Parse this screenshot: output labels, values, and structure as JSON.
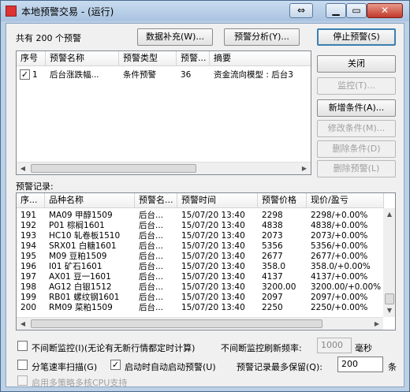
{
  "window": {
    "title": "本地预警交易 - (运行)"
  },
  "top": {
    "count_label": "共有 200 个预警",
    "data_fill_button": "数据补充(W)...",
    "analysis_button": "预警分析(Y)...",
    "stop_button": "停止预警(S)"
  },
  "side_buttons": {
    "close": "关闭",
    "monitor": "监控(T)...",
    "add_condition": "新增条件(A)...",
    "edit_condition": "修改条件(M)...",
    "delete_condition": "删除条件(D)",
    "delete_alert": "删除预警(L)"
  },
  "alert_list": {
    "columns": [
      "序号",
      "预警名称",
      "预警类型",
      "预警...",
      "摘要"
    ],
    "rows": [
      {
        "checked": true,
        "index": "1",
        "name": "后台涨跌幅...",
        "type": "条件预警",
        "count": "36",
        "summary": "资金流向模型 : 后台3"
      }
    ]
  },
  "records": {
    "label": "预警记录:",
    "columns": [
      "序...",
      "品种名称",
      "预警名...",
      "预警时间",
      "预警价格",
      "现价/盈亏"
    ],
    "rows": [
      {
        "no": "191",
        "name": "MA09 甲醇1509",
        "alert": "后台...",
        "time": "15/07/20 13:40",
        "price": "2298",
        "current": "2298/+0.00%"
      },
      {
        "no": "192",
        "name": "P01 棕榈1601",
        "alert": "后台...",
        "time": "15/07/20 13:40",
        "price": "4838",
        "current": "4838/+0.00%"
      },
      {
        "no": "193",
        "name": "HC10 轧卷板1510",
        "alert": "后台...",
        "time": "15/07/20 13:40",
        "price": "2073",
        "current": "2073/+0.00%"
      },
      {
        "no": "194",
        "name": "SRX01 白糖1601",
        "alert": "后台...",
        "time": "15/07/20 13:40",
        "price": "5356",
        "current": "5356/+0.00%"
      },
      {
        "no": "195",
        "name": "M09 豆粕1509",
        "alert": "后台...",
        "time": "15/07/20 13:40",
        "price": "2677",
        "current": "2677/+0.00%"
      },
      {
        "no": "196",
        "name": "I01 矿石1601",
        "alert": "后台...",
        "time": "15/07/20 13:40",
        "price": "358.0",
        "current": "358.0/+0.00%"
      },
      {
        "no": "197",
        "name": "AX01 豆一1601",
        "alert": "后台...",
        "time": "15/07/20 13:40",
        "price": "4137",
        "current": "4137/+0.00%"
      },
      {
        "no": "198",
        "name": "AG12 白银1512",
        "alert": "后台...",
        "time": "15/07/20 13:40",
        "price": "3200.00",
        "current": "3200.00/+0.00%"
      },
      {
        "no": "199",
        "name": "RB01 螺纹钢1601",
        "alert": "后台...",
        "time": "15/07/20 13:40",
        "price": "2097",
        "current": "2097/+0.00%"
      },
      {
        "no": "200",
        "name": "RM09 菜粕1509",
        "alert": "后台...",
        "time": "15/07/20 13:40",
        "price": "2250",
        "current": "2250/+0.00%"
      }
    ]
  },
  "options": {
    "continuous_monitor": "不间断监控(I)(无论有无新行情都定时计算)",
    "refresh_label": "不间断监控刷新频率:",
    "refresh_value": "1000",
    "refresh_unit": "毫秒",
    "tick_scan": "分笔速率扫描(G)",
    "auto_start": "启动时自动启动预警(U)",
    "max_records_label": "预警记录最多保留(Q):",
    "max_records_value": "200",
    "max_records_unit": "条",
    "multicore": "启用多策略多核CPU支持"
  },
  "icons": {
    "app": "app-icon",
    "swap": "swap-icon",
    "minimize": "minimize-icon",
    "maximize": "maximize-icon",
    "close": "close-icon",
    "check": "check-icon",
    "scroll_left": "arrow-left-icon",
    "scroll_right": "arrow-right-icon",
    "scroll_up": "arrow-up-icon",
    "scroll_down": "arrow-down-icon"
  },
  "colors": {
    "title_bar": "#bcd0e6",
    "close_button": "#c0392b",
    "default_button_border": "#3c7fb1",
    "client_bg": "#f0f0f0"
  }
}
